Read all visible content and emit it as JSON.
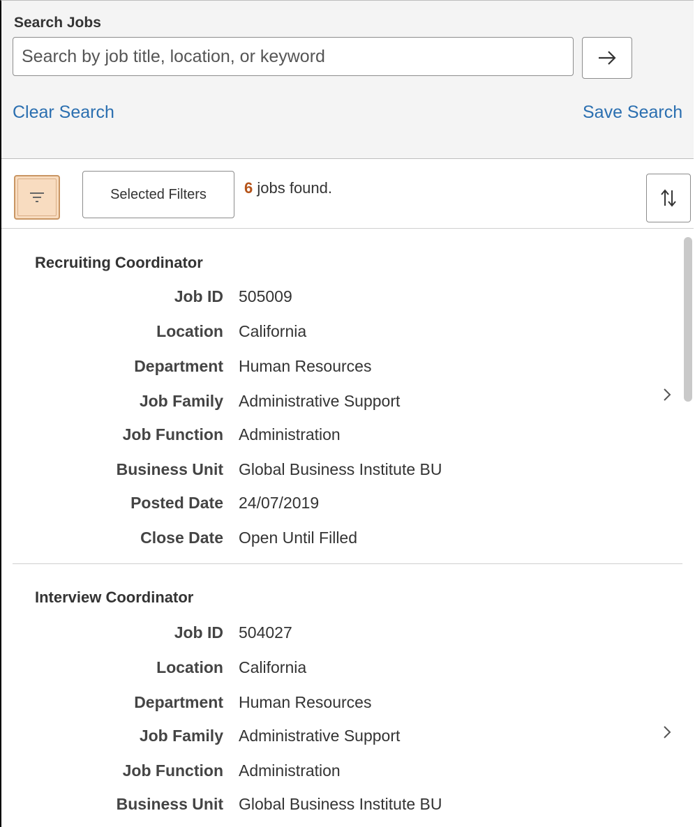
{
  "search": {
    "title": "Search Jobs",
    "placeholder": "Search by job title, location, or keyword",
    "value": "",
    "clear_label": "Clear Search",
    "save_label": "Save Search"
  },
  "toolbar": {
    "filter_icon": "filter-icon",
    "selected_filters_label": "Selected Filters",
    "jobs_count": "6",
    "jobs_found_text": " jobs found.",
    "sort_icon": "sort-icon"
  },
  "jobs": [
    {
      "title": "Recruiting Coordinator",
      "fields": [
        {
          "label": "Job ID",
          "value": "505009"
        },
        {
          "label": "Location",
          "value": "California"
        },
        {
          "label": "Department",
          "value": "Human Resources"
        },
        {
          "label": "Job Family",
          "value": "Administrative Support"
        },
        {
          "label": "Job Function",
          "value": "Administration"
        },
        {
          "label": "Business Unit",
          "value": "Global Business Institute BU"
        },
        {
          "label": "Posted Date",
          "value": "24/07/2019"
        },
        {
          "label": "Close Date",
          "value": "Open Until Filled"
        }
      ]
    },
    {
      "title": "Interview Coordinator",
      "fields": [
        {
          "label": "Job ID",
          "value": "504027"
        },
        {
          "label": "Location",
          "value": "California"
        },
        {
          "label": "Department",
          "value": "Human Resources"
        },
        {
          "label": "Job Family",
          "value": "Administrative Support"
        },
        {
          "label": "Job Function",
          "value": "Administration"
        },
        {
          "label": "Business Unit",
          "value": "Global Business Institute BU"
        }
      ]
    }
  ],
  "colors": {
    "link": "#2b6fb0",
    "count_accent": "#b5541a",
    "filter_active_bg": "#f8dcc0",
    "header_bg": "#f4f4f4"
  }
}
